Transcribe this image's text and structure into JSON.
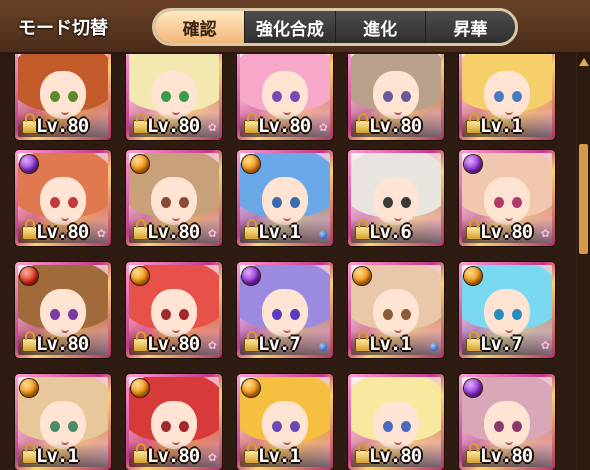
{
  "header": {
    "mode_label": "モード切替",
    "tabs": [
      {
        "label": "確認",
        "active": true
      },
      {
        "label": "強化合成",
        "active": false
      },
      {
        "label": "進化",
        "active": false
      },
      {
        "label": "昇華",
        "active": false
      }
    ]
  },
  "cards": [
    {
      "level": "Lv.80",
      "element": "none",
      "hair": "#c25a2a",
      "eye": "#5a8a2a",
      "badge": "none"
    },
    {
      "level": "Lv.80",
      "element": "none",
      "hair": "#f3e8b0",
      "eye": "#3a9a4a",
      "badge": "sakura"
    },
    {
      "level": "Lv.80",
      "element": "none",
      "hair": "#f7a8c8",
      "eye": "#7a4ab0",
      "badge": "sakura"
    },
    {
      "level": "Lv.80",
      "element": "none",
      "hair": "#b8a08a",
      "eye": "#6a5a9a",
      "badge": "none"
    },
    {
      "level": "Lv.1",
      "element": "none",
      "hair": "#f5d06a",
      "eye": "#4a7ac0",
      "badge": "none"
    },
    {
      "level": "Lv.80",
      "element": "purple",
      "hair": "#e07850",
      "eye": "#c03a3a",
      "badge": "sakura"
    },
    {
      "level": "Lv.80",
      "element": "orange",
      "hair": "#c8a07a",
      "eye": "#8a4a3a",
      "badge": "sakura"
    },
    {
      "level": "Lv.1",
      "element": "orange",
      "hair": "#6aa8e8",
      "eye": "#3a6ab0",
      "badge": "gem"
    },
    {
      "level": "Lv.6",
      "element": "none",
      "hair": "#e8e4e0",
      "eye": "#3a3a3a",
      "badge": "none"
    },
    {
      "level": "Lv.80",
      "element": "purple",
      "hair": "#f0c8b0",
      "eye": "#b03a6a",
      "badge": "sakura"
    },
    {
      "level": "Lv.80",
      "element": "red",
      "hair": "#a06a3a",
      "eye": "#7a3aa0",
      "badge": "none"
    },
    {
      "level": "Lv.80",
      "element": "orange",
      "hair": "#e8504a",
      "eye": "#a02a2a",
      "badge": "sakura"
    },
    {
      "level": "Lv.7",
      "element": "purple",
      "hair": "#9a8ae0",
      "eye": "#5a3ac0",
      "badge": "gem"
    },
    {
      "level": "Lv.1",
      "element": "orange",
      "hair": "#e8c8a8",
      "eye": "#8a5a3a",
      "badge": "gem"
    },
    {
      "level": "Lv.7",
      "element": "orange",
      "hair": "#7ad8f0",
      "eye": "#2a8ac0",
      "badge": "sakura"
    },
    {
      "level": "Lv.1",
      "element": "orange",
      "hair": "#e8c89a",
      "eye": "#4a8a6a",
      "badge": "none"
    },
    {
      "level": "Lv.80",
      "element": "orange",
      "hair": "#d83a3a",
      "eye": "#a02a2a",
      "badge": "sakura"
    },
    {
      "level": "Lv.1",
      "element": "orange",
      "hair": "#f5c040",
      "eye": "#6a4ab0",
      "badge": "none"
    },
    {
      "level": "Lv.80",
      "element": "none",
      "hair": "#f8e8a0",
      "eye": "#4a6ac0",
      "badge": "none"
    },
    {
      "level": "Lv.80",
      "element": "purple",
      "hair": "#d8a8b8",
      "eye": "#8a3a6a",
      "badge": "none"
    }
  ]
}
